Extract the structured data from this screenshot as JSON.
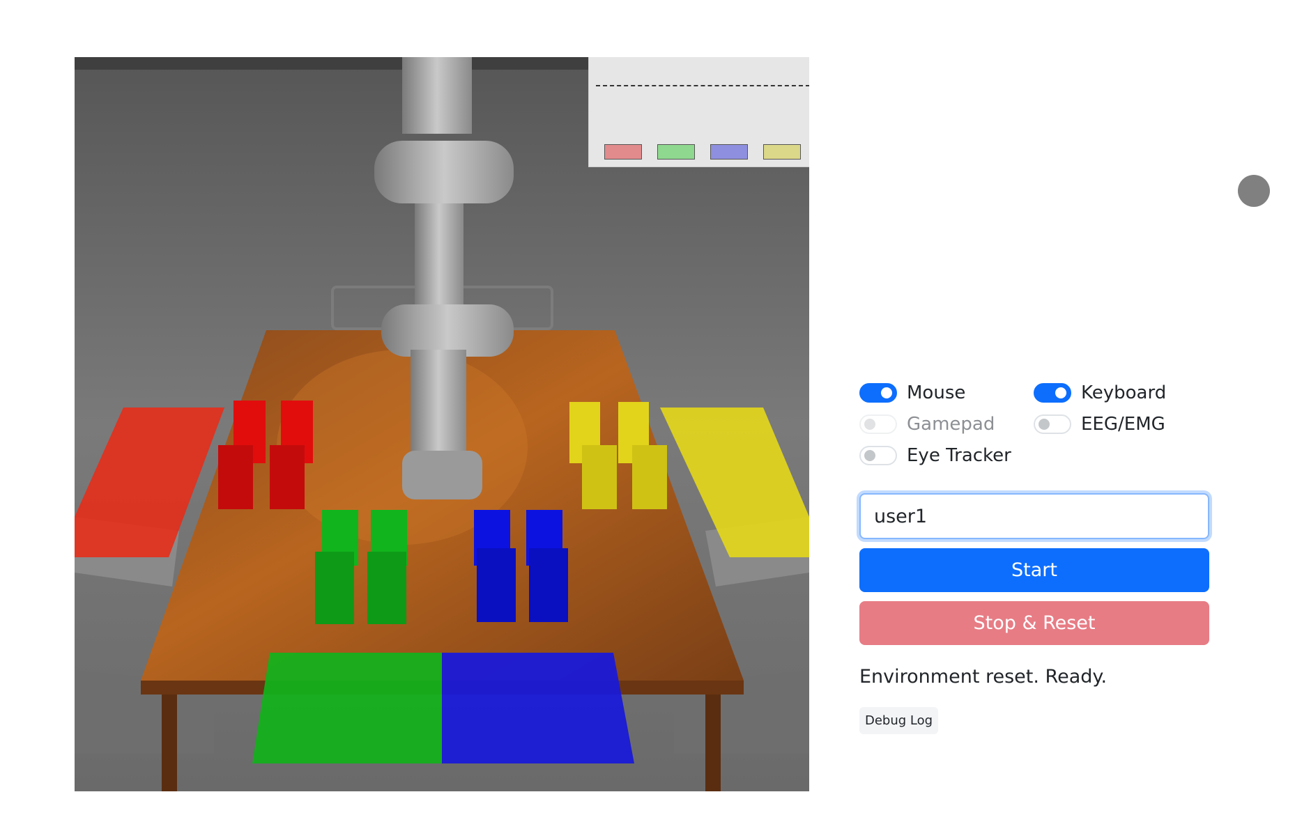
{
  "simulation": {
    "caption": "",
    "overlay": {
      "bin_colors": [
        "#e28b8d",
        "#8fd88f",
        "#8f8fe0",
        "#dcd88a"
      ]
    },
    "blocks": {
      "red": "#e10d0d",
      "green": "#11b41c",
      "blue": "#0c12e0",
      "yellow": "#e2d41a"
    }
  },
  "status_indicator": {
    "color": "#808080"
  },
  "input_toggles": [
    {
      "label": "Mouse",
      "checked": true,
      "disabled": false
    },
    {
      "label": "Keyboard",
      "checked": true,
      "disabled": false
    },
    {
      "label": "Gamepad",
      "checked": false,
      "disabled": true
    },
    {
      "label": "EEG/EMG",
      "checked": false,
      "disabled": false
    },
    {
      "label": "Eye Tracker",
      "checked": false,
      "disabled": false
    }
  ],
  "user_input": {
    "value": "user1",
    "placeholder": ""
  },
  "buttons": {
    "start": "Start",
    "stop_reset": "Stop & Reset",
    "debug_log": "Debug Log"
  },
  "status_message": "Environment reset. Ready.",
  "colors": {
    "primary": "#0d6efd",
    "danger_faded": "#e77c85"
  }
}
